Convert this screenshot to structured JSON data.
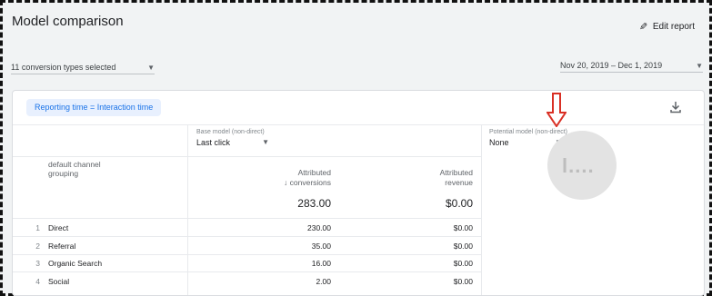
{
  "header": {
    "title": "Model comparison",
    "edit_label": "Edit report"
  },
  "filters": {
    "conversion_types": "11 conversion types selected",
    "date_range": "Nov 20, 2019 – Dec 1, 2019"
  },
  "card": {
    "chip_label": "Reporting time = Interaction time",
    "base_model": {
      "label": "Base model (non-direct)",
      "value": "Last click"
    },
    "potential_model": {
      "label": "Potential model (non-direct)",
      "value": "None"
    },
    "dimension_header": "default channel grouping",
    "columns": {
      "conversions": [
        "Attributed",
        "↓ conversions"
      ],
      "revenue": [
        "Attributed",
        "revenue"
      ]
    },
    "totals": {
      "conversions": "283.00",
      "revenue": "$0.00"
    },
    "rows": [
      {
        "num": "1",
        "name": "Direct",
        "conversions": "230.00",
        "revenue": "$0.00"
      },
      {
        "num": "2",
        "name": "Referral",
        "conversions": "35.00",
        "revenue": "$0.00"
      },
      {
        "num": "3",
        "name": "Organic Search",
        "conversions": "16.00",
        "revenue": "$0.00"
      },
      {
        "num": "4",
        "name": "Social",
        "conversions": "2.00",
        "revenue": "$0.00"
      }
    ]
  },
  "colors": {
    "accent": "#1a73e8",
    "annotation_arrow": "#d93025",
    "page_bg": "#f1f3f4"
  },
  "icons": [
    "pencil-icon",
    "dropdown-arrow-icon",
    "download-icon",
    "loading-spinner-icon",
    "annotation-arrow-icon"
  ]
}
